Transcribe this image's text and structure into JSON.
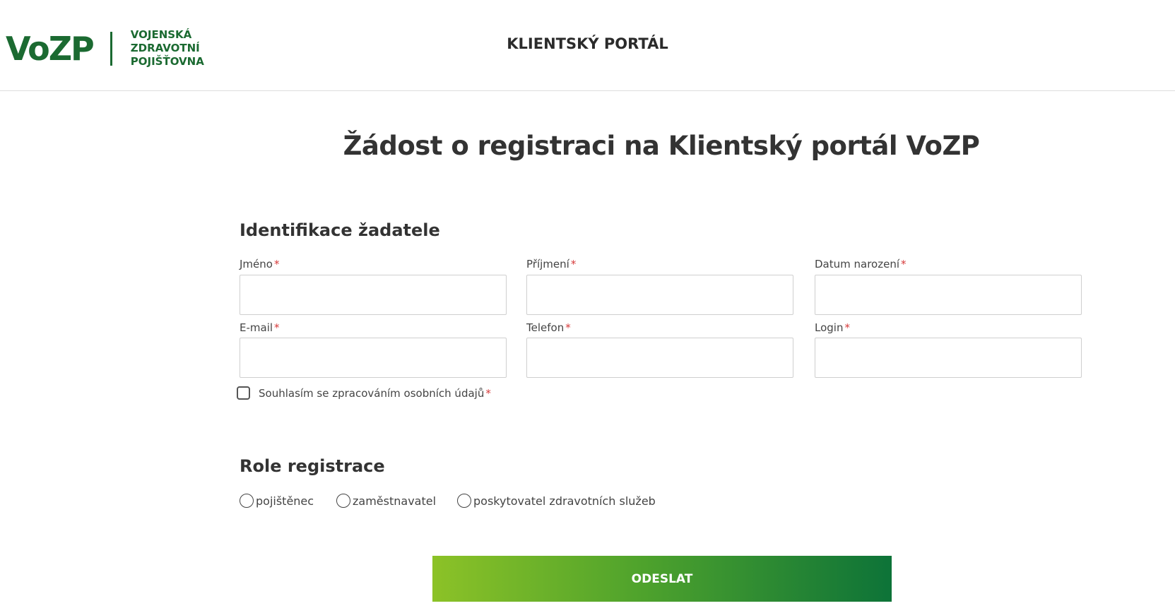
{
  "header": {
    "logo": {
      "mark": "VoZP",
      "line1": "VOJENSKÁ",
      "line2": "ZDRAVOTNÍ",
      "line3": "POJIŠŤOVNA"
    },
    "portal_title": "KLIENTSKÝ PORTÁL"
  },
  "page_title": "Žádost o registraci na Klientský portál VoZP",
  "identification": {
    "title": "Identifikace žadatele",
    "required_mark": "*",
    "fields": [
      {
        "label": "Jméno",
        "value": ""
      },
      {
        "label": "Příjmení",
        "value": ""
      },
      {
        "label": "Datum narození",
        "value": ""
      },
      {
        "label": "E-mail",
        "value": ""
      },
      {
        "label": "Telefon",
        "value": ""
      },
      {
        "label": "Login",
        "value": ""
      }
    ],
    "consent_label": "Souhlasím se zpracováním osobních údajů"
  },
  "role": {
    "title": "Role registrace",
    "options": [
      {
        "label": "pojištěnec"
      },
      {
        "label": "zaměstnavatel"
      },
      {
        "label": "poskytovatel zdravotních služeb"
      }
    ]
  },
  "submit_label": "ODESLAT",
  "colors": {
    "brand_green": "#1b6a31",
    "required_red": "#d63a3a",
    "button_gradient_start": "#8cc227",
    "button_gradient_end": "#0d7338"
  }
}
